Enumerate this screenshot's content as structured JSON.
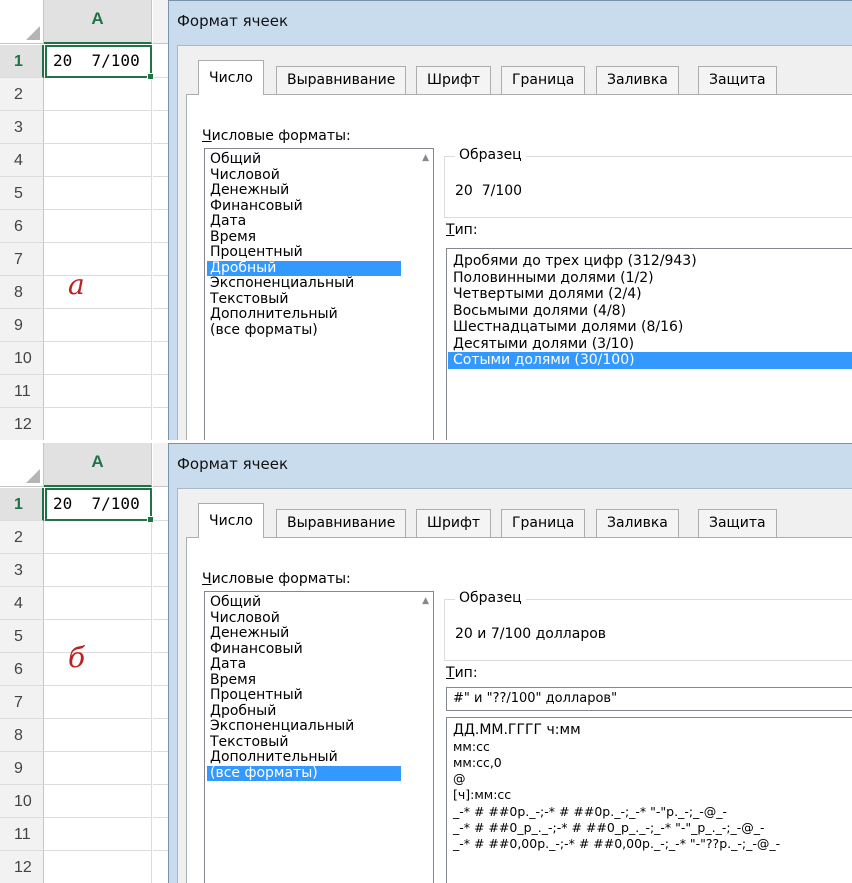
{
  "panels": [
    {
      "label": "а",
      "column_header": "A",
      "rows": [
        "1",
        "2",
        "3",
        "4",
        "5",
        "6",
        "7",
        "8",
        "9",
        "10",
        "11",
        "12"
      ],
      "cell_a1": "20  7/100",
      "dialog": {
        "title": "Формат ячеек",
        "tabs": [
          "Число",
          "Выравнивание",
          "Шрифт",
          "Граница",
          "Заливка",
          "Защита"
        ],
        "formats_label_underlined": "Ч",
        "formats_label_rest": "исловые форматы:",
        "formats": [
          "Общий",
          "Числовой",
          "Денежный",
          "Финансовый",
          "Дата",
          "Время",
          "Процентный",
          "Дробный",
          "Экспоненциальный",
          "Текстовый",
          "Дополнительный",
          "(все форматы)"
        ],
        "selected_format": "Дробный",
        "sample_label": "Образец",
        "sample_value": "20  7/100",
        "type_label_underlined": "Т",
        "type_label_rest": "ип:",
        "types": [
          "Дробями до трех цифр (312/943)",
          "Половинными долями (1/2)",
          "Четвертыми долями (2/4)",
          "Восьмыми долями (4/8)",
          "Шестнадцатыми долями (8/16)",
          "Десятыми долями (3/10)",
          "Сотыми долями (30/100)"
        ],
        "selected_type": "Сотыми долями (30/100)"
      }
    },
    {
      "label": "б",
      "column_header": "A",
      "rows": [
        "1",
        "2",
        "3",
        "4",
        "5",
        "6",
        "7",
        "8",
        "9",
        "10",
        "11",
        "12"
      ],
      "cell_a1": "20  7/100",
      "dialog": {
        "title": "Формат ячеек",
        "tabs": [
          "Число",
          "Выравнивание",
          "Шрифт",
          "Граница",
          "Заливка",
          "Защита"
        ],
        "formats_label_underlined": "Ч",
        "formats_label_rest": "исловые форматы:",
        "formats": [
          "Общий",
          "Числовой",
          "Денежный",
          "Финансовый",
          "Дата",
          "Время",
          "Процентный",
          "Дробный",
          "Экспоненциальный",
          "Текстовый",
          "Дополнительный",
          "(все форматы)"
        ],
        "selected_format": "(все форматы)",
        "sample_label": "Образец",
        "sample_value": "20 и 7/100 долларов",
        "type_label_underlined": "Т",
        "type_label_rest": "ип:",
        "type_input": "#\" и \"??/100\" долларов\"",
        "types": [
          "ДД.ММ.ГГГГ ч:мм",
          "мм:сс",
          "мм:сс,0",
          "@",
          "[ч]:мм:сс",
          "_-* # ##0р._-;-* # ##0р._-;_-* \"-\"р._-;_-@_-",
          "_-* # ##0_р_._-;-* # ##0_р_._-;_-* \"-\"_р_._-;_-@_-",
          "_-* # ##0,00р._-;-* # ##0,00р._-;_-* \"-\"??р._-;_-@_-"
        ],
        "selected_type": ""
      }
    }
  ],
  "colors": {
    "excel_green": "#217346",
    "selection_blue": "#3399ff",
    "dialog_frame": "#c9dced"
  }
}
